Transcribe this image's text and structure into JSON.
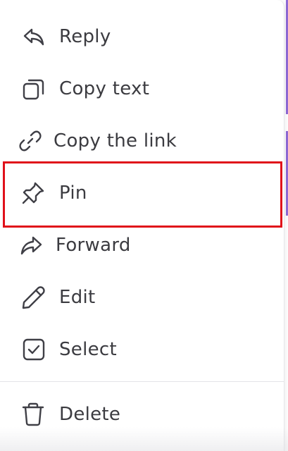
{
  "menu": {
    "items": [
      {
        "id": "reply",
        "label": "Reply",
        "icon": "reply-icon"
      },
      {
        "id": "copy-text",
        "label": "Copy text",
        "icon": "copy-icon"
      },
      {
        "id": "copy-link",
        "label": "Copy the link",
        "icon": "link-icon"
      },
      {
        "id": "pin",
        "label": "Pin",
        "icon": "pin-icon"
      },
      {
        "id": "forward",
        "label": "Forward",
        "icon": "forward-icon"
      },
      {
        "id": "edit",
        "label": "Edit",
        "icon": "pencil-icon"
      },
      {
        "id": "select",
        "label": "Select",
        "icon": "checkbox-icon"
      },
      {
        "id": "delete",
        "label": "Delete",
        "icon": "trash-icon"
      }
    ],
    "highlighted_item": "pin"
  },
  "colors": {
    "text": "#3b3b40",
    "icon": "#3f3f46",
    "highlight_border": "#e0101a",
    "accent": "#8f6ad6"
  }
}
